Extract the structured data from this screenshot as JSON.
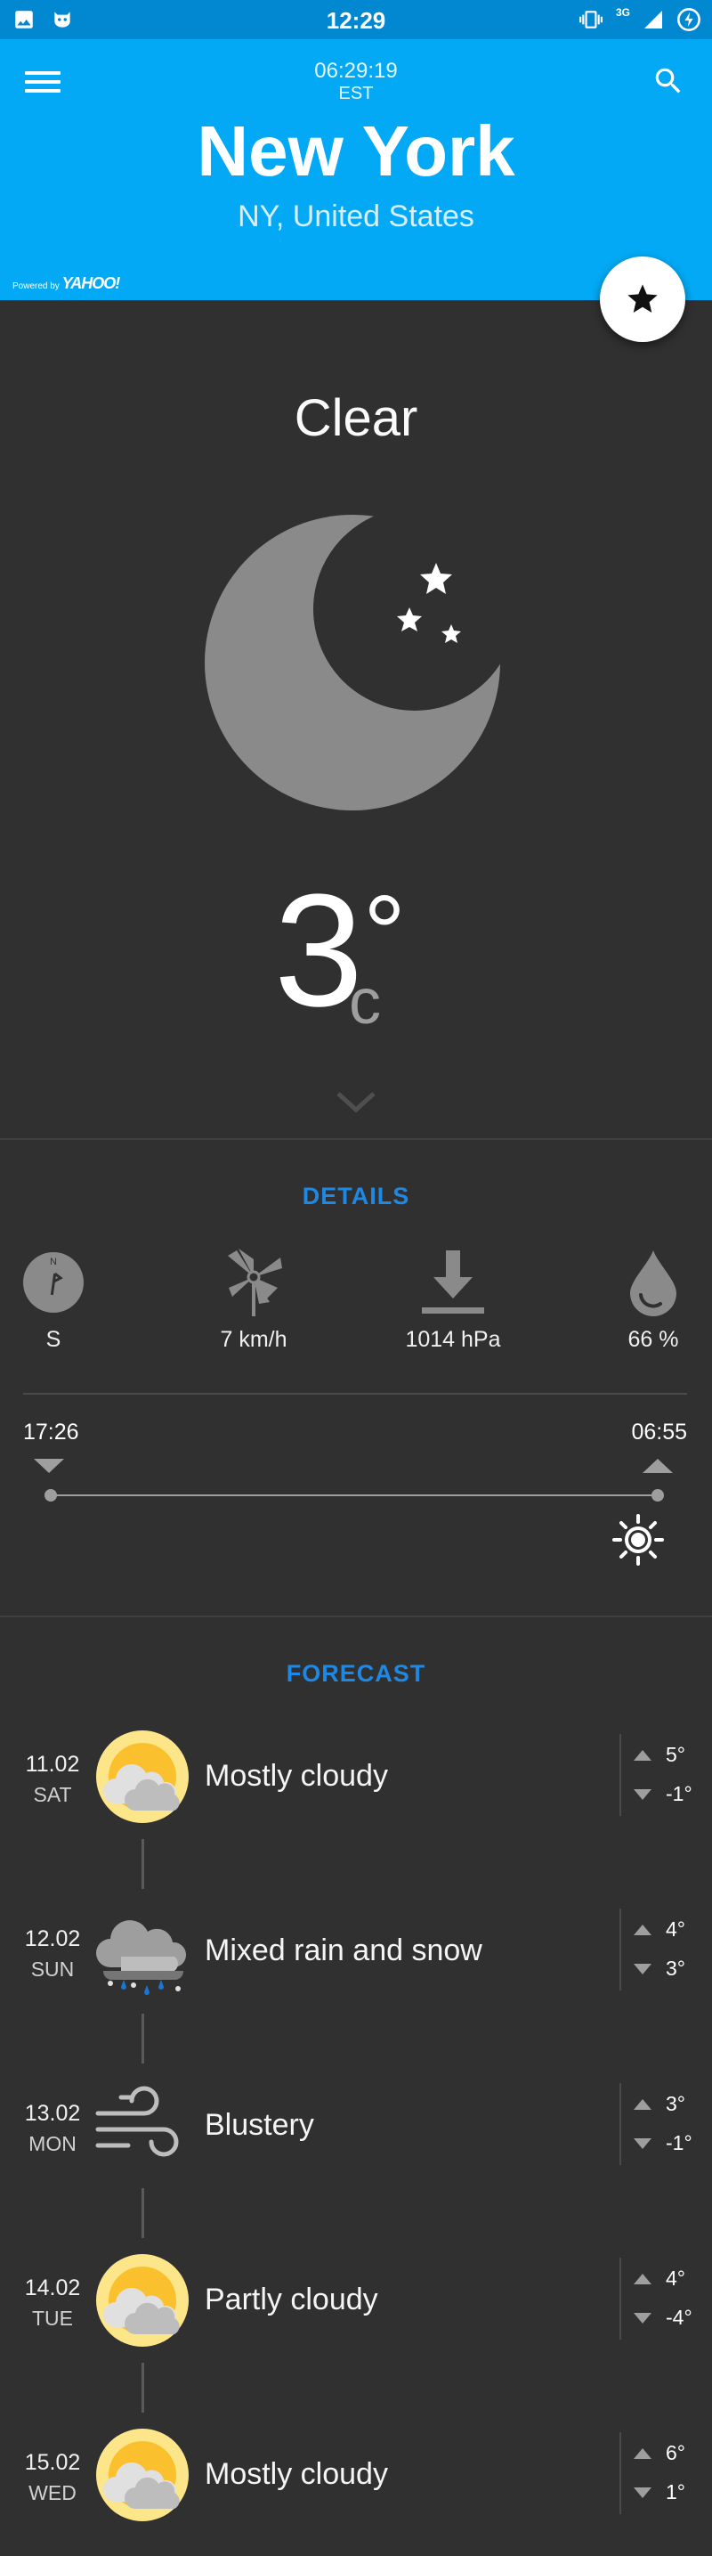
{
  "status_bar": {
    "time": "12:29",
    "network": "3G"
  },
  "header": {
    "local_time": "06:29:19",
    "timezone": "EST",
    "city": "New York",
    "region": "NY, United States",
    "powered_prefix": "Powered by",
    "powered_brand": "YAHOO!"
  },
  "current": {
    "condition": "Clear",
    "temperature": "3",
    "degree_symbol": "°",
    "unit": "c",
    "icon": "clear-night-moon-icon"
  },
  "details": {
    "title": "DETAILS",
    "compass_n": "N",
    "wind_direction": "S",
    "wind_speed": "7 km/h",
    "pressure": "1014 hPa",
    "humidity": "66 %",
    "sunset": "17:26",
    "sunrise": "06:55"
  },
  "forecast": {
    "title": "FORECAST",
    "days": [
      {
        "date": "11.02",
        "day": "SAT",
        "text": "Mostly cloudy",
        "high": "5°",
        "low": "-1°",
        "icon": "sun-cloud-icon"
      },
      {
        "date": "12.02",
        "day": "SUN",
        "text": "Mixed rain and snow",
        "high": "4°",
        "low": "3°",
        "icon": "rain-snow-icon"
      },
      {
        "date": "13.02",
        "day": "MON",
        "text": "Blustery",
        "high": "3°",
        "low": "-1°",
        "icon": "wind-icon"
      },
      {
        "date": "14.02",
        "day": "TUE",
        "text": "Partly cloudy",
        "high": "4°",
        "low": "-4°",
        "icon": "sun-cloud-icon"
      },
      {
        "date": "15.02",
        "day": "WED",
        "text": "Mostly cloudy",
        "high": "6°",
        "low": "1°",
        "icon": "sun-cloud-icon"
      }
    ]
  },
  "colors": {
    "status_bar": "#0288d1",
    "header": "#03a9f4",
    "background": "#303030",
    "accent": "#1e88e5"
  }
}
